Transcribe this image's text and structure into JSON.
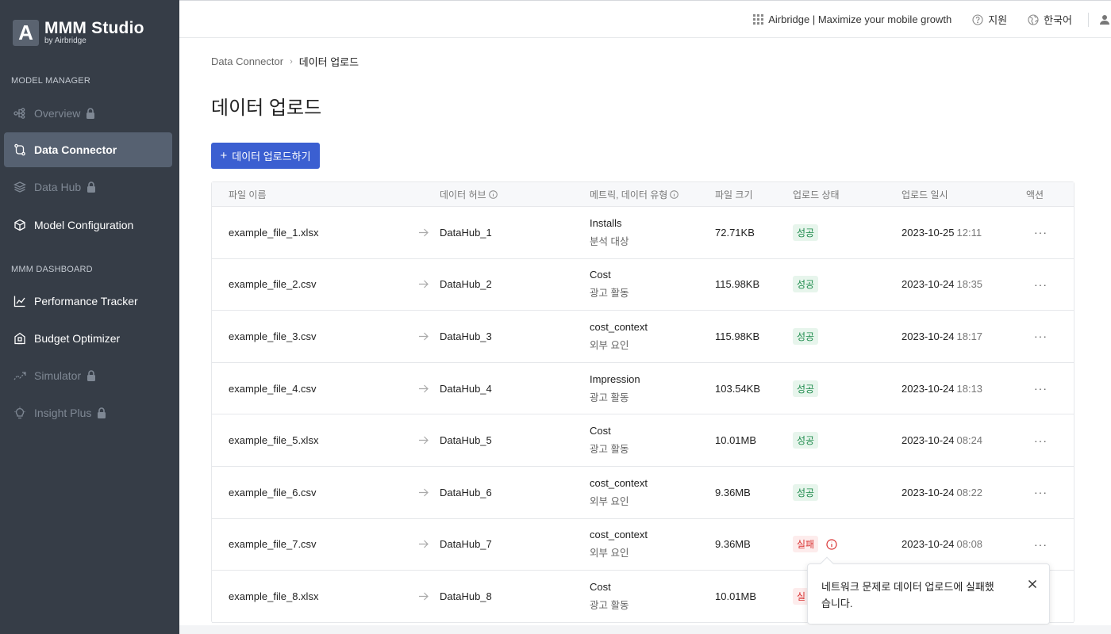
{
  "brand": {
    "mark": "A",
    "title": "MMM Studio",
    "subtitle": "by Airbridge"
  },
  "sidebar": {
    "section_model": "MODEL MANAGER",
    "section_dashboard": "MMM DASHBOARD",
    "items": [
      {
        "label": "Overview",
        "icon": "tree-icon",
        "locked": true,
        "active": false
      },
      {
        "label": "Data Connector",
        "icon": "connector-icon",
        "locked": false,
        "active": true
      },
      {
        "label": "Data Hub",
        "icon": "layers-icon",
        "locked": true,
        "active": false
      },
      {
        "label": "Model Configuration",
        "icon": "cube-icon",
        "locked": false,
        "active": false
      },
      {
        "label": "Performance Tracker",
        "icon": "line-chart-icon",
        "locked": false,
        "active": false
      },
      {
        "label": "Budget Optimizer",
        "icon": "building-icon",
        "locked": false,
        "active": false
      },
      {
        "label": "Simulator",
        "icon": "trend-icon",
        "locked": true,
        "active": false
      },
      {
        "label": "Insight Plus",
        "icon": "bulb-icon",
        "locked": true,
        "active": false
      }
    ]
  },
  "topbar": {
    "app_link": "Airbridge | Maximize your mobile growth",
    "support": "지원",
    "language": "한국어"
  },
  "breadcrumb": {
    "parent": "Data Connector",
    "current": "데이터 업로드"
  },
  "page": {
    "title": "데이터 업로드",
    "upload_button": "데이터 업로드하기"
  },
  "table": {
    "headers": {
      "file_name": "파일 이름",
      "data_hub": "데이터 허브",
      "metric": "메트릭, 데이터 유형",
      "file_size": "파일 크기",
      "status": "업로드 상태",
      "datetime": "업로드 일시",
      "action": "액션"
    },
    "rows": [
      {
        "file": "example_file_1.xlsx",
        "hub": "DataHub_1",
        "metric": "Installs",
        "type": "분석 대상",
        "size": "72.71KB",
        "status": "성공",
        "ok": true,
        "date": "2023-10-25",
        "time": "12:11"
      },
      {
        "file": "example_file_2.csv",
        "hub": "DataHub_2",
        "metric": "Cost",
        "type": "광고 활동",
        "size": "115.98KB",
        "status": "성공",
        "ok": true,
        "date": "2023-10-24",
        "time": "18:35"
      },
      {
        "file": "example_file_3.csv",
        "hub": "DataHub_3",
        "metric": "cost_context",
        "type": "외부 요인",
        "size": "115.98KB",
        "status": "성공",
        "ok": true,
        "date": "2023-10-24",
        "time": "18:17"
      },
      {
        "file": "example_file_4.csv",
        "hub": "DataHub_4",
        "metric": "Impression",
        "type": "광고 활동",
        "size": "103.54KB",
        "status": "성공",
        "ok": true,
        "date": "2023-10-24",
        "time": "18:13"
      },
      {
        "file": "example_file_5.xlsx",
        "hub": "DataHub_5",
        "metric": "Cost",
        "type": "광고 활동",
        "size": "10.01MB",
        "status": "성공",
        "ok": true,
        "date": "2023-10-24",
        "time": "08:24"
      },
      {
        "file": "example_file_6.csv",
        "hub": "DataHub_6",
        "metric": "cost_context",
        "type": "외부 요인",
        "size": "9.36MB",
        "status": "성공",
        "ok": true,
        "date": "2023-10-24",
        "time": "08:22"
      },
      {
        "file": "example_file_7.csv",
        "hub": "DataHub_7",
        "metric": "cost_context",
        "type": "외부 요인",
        "size": "9.36MB",
        "status": "실패",
        "ok": false,
        "date": "2023-10-24",
        "time": "08:08"
      },
      {
        "file": "example_file_8.xlsx",
        "hub": "DataHub_8",
        "metric": "Cost",
        "type": "광고 활동",
        "size": "10.01MB",
        "status": "실",
        "ok": false,
        "date": "",
        "time": ""
      }
    ],
    "more_label": "···"
  },
  "tooltip": {
    "message": "네트워크 문제로 데이터 업로드에 실패했습니다."
  },
  "colors": {
    "sidebar_bg": "#363d47",
    "accent": "#3b5fd1",
    "success": "#1b8a4a",
    "error": "#d93232"
  }
}
